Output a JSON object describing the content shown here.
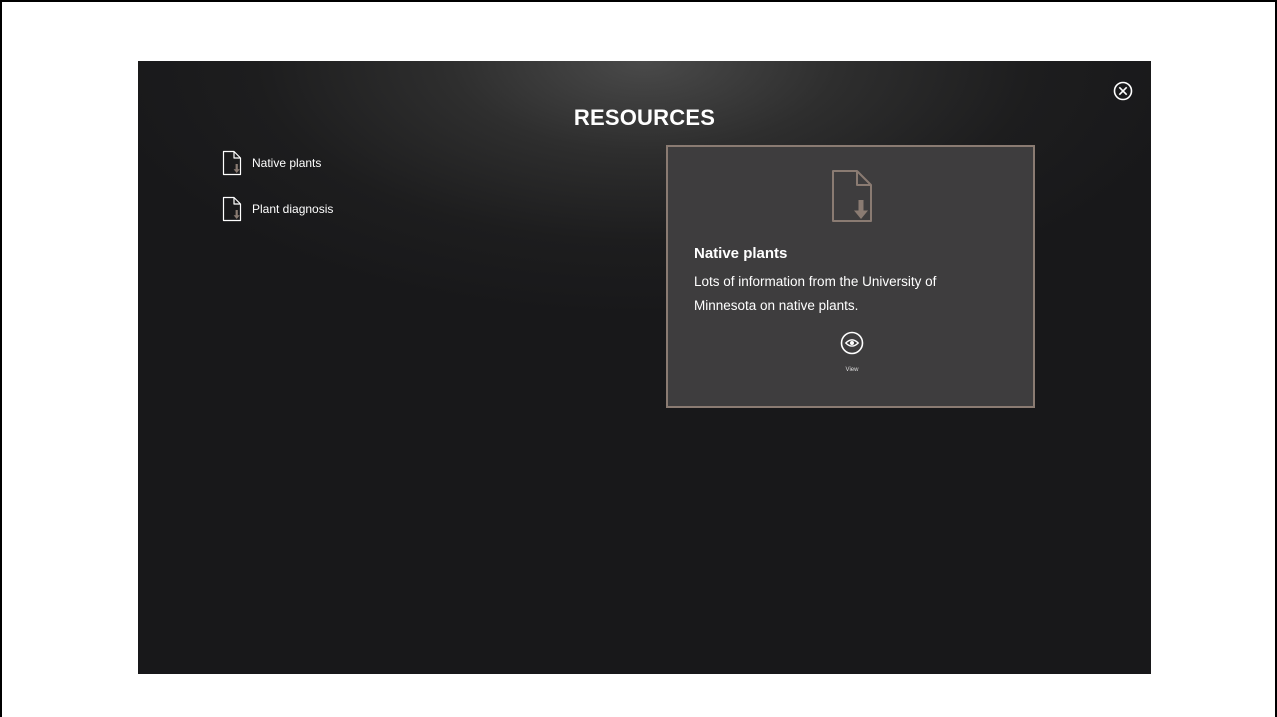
{
  "page": {
    "title": "RESOURCES"
  },
  "resources": [
    {
      "label": "Native plants",
      "icon": "document-download-icon"
    },
    {
      "label": "Plant diagnosis",
      "icon": "document-download-icon"
    }
  ],
  "detail_card": {
    "title": "Native plants",
    "description": "Lots of information from the University of Minnesota on native plants.",
    "view_label": "View",
    "icon": "document-download-icon",
    "view_icon": "eye-icon"
  },
  "close": {
    "icon": "close-circle-icon"
  },
  "colors": {
    "background": "#1d1d1e",
    "card_background": "#3e3d3e",
    "card_border": "#8a7b72",
    "icon_accent": "#8a7b72",
    "text": "#ffffff"
  }
}
